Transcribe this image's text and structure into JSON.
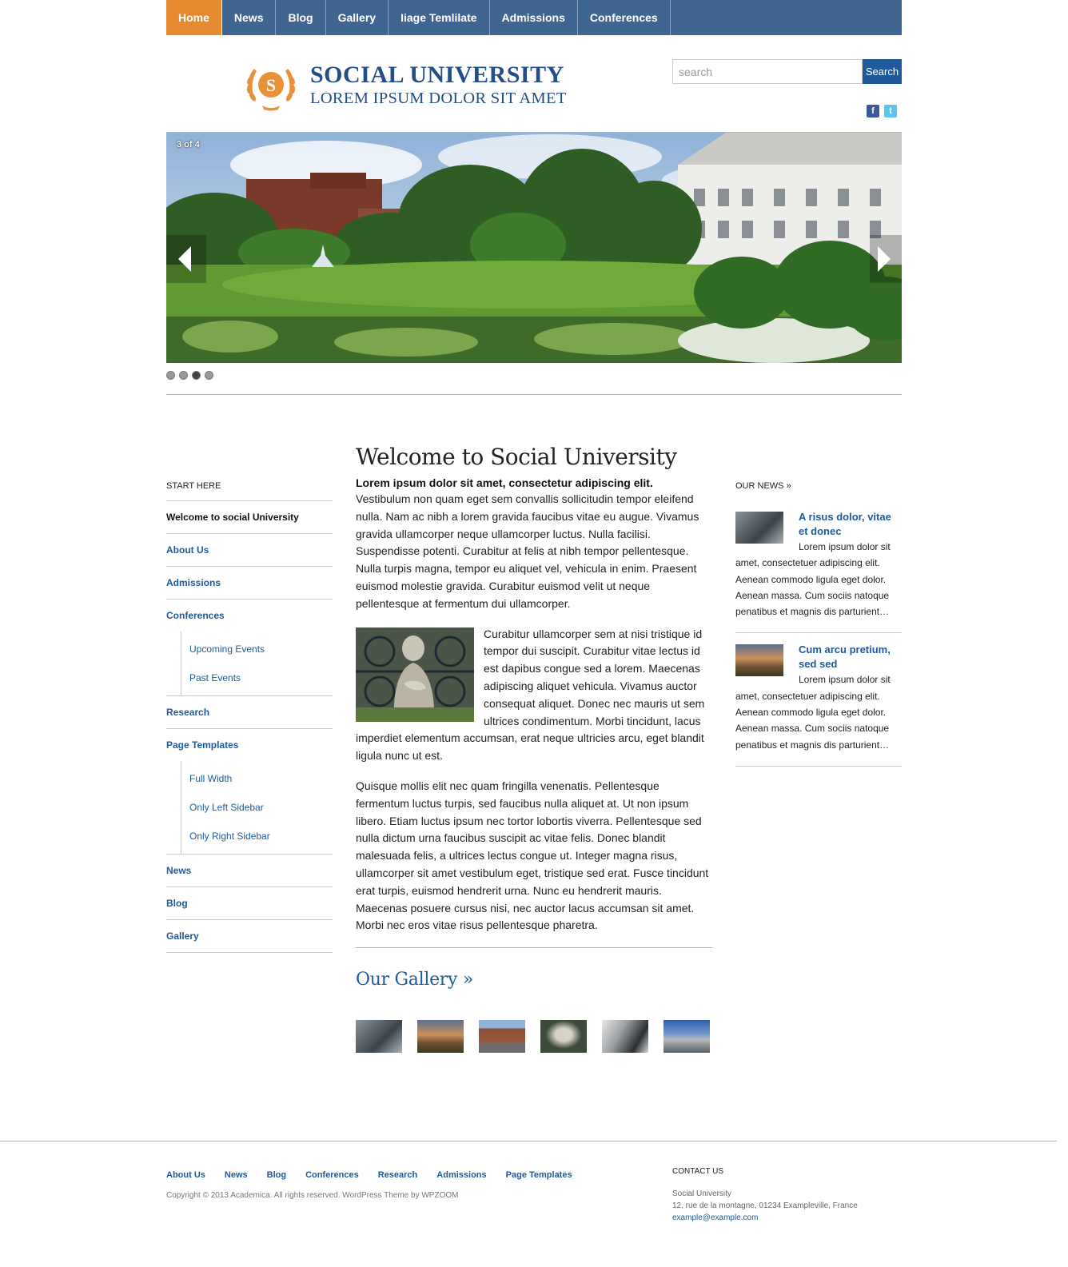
{
  "colors": {
    "nav_bg": "#3f6591",
    "nav_active": "#e58a2e",
    "accent": "#e5a868",
    "link": "#1f5a9a"
  },
  "topnav": {
    "items": [
      {
        "label": "Home"
      },
      {
        "label": "News"
      },
      {
        "label": "Blog"
      },
      {
        "label": "Gallery"
      },
      {
        "label": "Iiage Temlilate"
      },
      {
        "label": "Admissions"
      },
      {
        "label": "Conferences"
      }
    ],
    "active_index": 0
  },
  "header": {
    "logo_letter": "S",
    "title": "SOCIAL UNIVERSITY",
    "tagline": "LOREM IPSUM DOLOR SIT AMET",
    "search_placeholder": "search",
    "search_button": "Search",
    "social_icons": [
      "facebook-icon",
      "twitter-icon"
    ]
  },
  "slider": {
    "counter": "3 of 4",
    "slide_count": 4,
    "current": 3
  },
  "sidebar": {
    "title": "START HERE",
    "items": [
      {
        "label": "Welcome to social University"
      },
      {
        "label": "About Us"
      },
      {
        "label": "Admissions"
      },
      {
        "label": "Conferences"
      },
      {
        "label": "Upcoming Events"
      },
      {
        "label": "Past Events"
      },
      {
        "label": "Research"
      },
      {
        "label": "Page Templates"
      },
      {
        "label": "Full Width"
      },
      {
        "label": "Only Left Sidebar"
      },
      {
        "label": "Only Right Sidebar"
      },
      {
        "label": "News"
      },
      {
        "label": "Blog"
      },
      {
        "label": "Gallery"
      }
    ]
  },
  "content": {
    "heading": "Welcome to Social University",
    "lead": "Lorem ipsum dolor sit amet, consectetur adipiscing elit.",
    "p1": "Vestibulum non quam eget sem convallis sollicitudin tempor eleifend nulla. Nam ac nibh a lorem gravida faucibus vitae eu augue. Vivamus gravida ullamcorper neque ullamcorper luctus. Nulla facilisi. Suspendisse potenti. Curabitur at felis at nibh tempor pellentesque. Nulla turpis magna, tempor eu aliquet vel, vehicula in enim. Praesent euismod molestie gravida. Curabitur euismod velit ut neque pellentesque at fermentum dui ullamcorper.",
    "p2": "Curabitur ullamcorper sem at nisi tristique id tempor dui suscipit. Curabitur vitae lectus id est dapibus congue sed a lorem. Maecenas adipiscing aliquet vehicula. Vivamus auctor consequat aliquet. Donec nec mauris ut sem ultrices condimentum. Morbi tincidunt, lacus imperdiet elementum accumsan, erat neque ultricies arcu, eget blandit ligula nunc ut est.",
    "p3": "Quisque mollis elit nec quam fringilla venenatis. Pellentesque fermentum luctus turpis, sed faucibus nulla aliquet at. Ut non ipsum libero. Etiam luctus ipsum nec tortor lobortis viverra. Pellentesque sed nulla dictum urna faucibus suscipit ac vitae felis. Donec blandit malesuada felis, a ultrices lectus congue ut. Integer magna risus, ullamcorper sit amet vestibulum eget, tristique sed erat. Fusce tincidunt erat turpis, euismod hendrerit urna. Nunc eu hendrerit mauris. Maecenas posuere cursus nisi, nec auctor lacus accumsan sit amet. Morbi nec eros vitae risus pellentesque pharetra.",
    "gallery_title": "Our Gallery »"
  },
  "news": {
    "title": "OUR NEWS",
    "items": [
      {
        "headline": "A risus dolor, vitae et donec",
        "body": "Lorem ipsum dolor sit amet, consectetuer adipiscing elit. Aenean commodo ligula eget dolor. Aenean massa. Cum sociis natoque penatibus et magnis dis parturient…"
      },
      {
        "headline": "Cum arcu pretium, sed sed",
        "body": "Lorem ipsum dolor sit amet, consectetuer adipiscing elit. Aenean commodo ligula eget dolor. Aenean massa. Cum sociis natoque penatibus et magnis dis parturient…"
      }
    ]
  },
  "footer": {
    "nav": [
      "About Us",
      "News",
      "Blog",
      "Conferences",
      "Research",
      "Admissions",
      "Page Templates"
    ],
    "copyright": "Copyright © 2013 Academica. All rights reserved. WordPress Theme by WPZOOM",
    "contact_title": "CONTACT US",
    "contact_name": "Social University",
    "contact_address": "12, rue de la montagne, 01234 Exampleville, France",
    "contact_email": "example@example.com"
  }
}
